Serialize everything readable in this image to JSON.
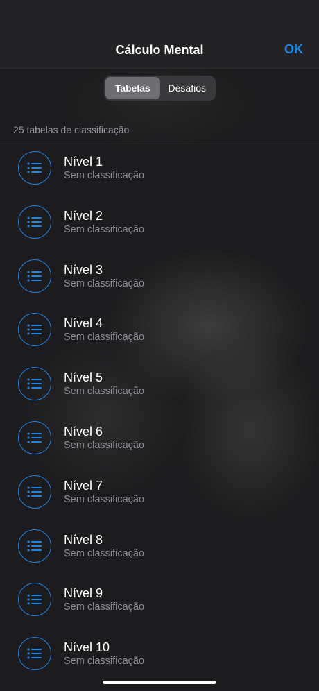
{
  "header": {
    "title": "Cálculo Mental",
    "ok_label": "OK"
  },
  "segments": [
    "Tabelas",
    "Desafios"
  ],
  "selected_segment": "Tabelas",
  "section": {
    "header": "25 tabelas de classificação"
  },
  "rows": [
    {
      "title": "Nível 1",
      "subtitle": "Sem classificação"
    },
    {
      "title": "Nível 2",
      "subtitle": "Sem classificação"
    },
    {
      "title": "Nível 3",
      "subtitle": "Sem classificação"
    },
    {
      "title": "Nível 4",
      "subtitle": "Sem classificação"
    },
    {
      "title": "Nível 5",
      "subtitle": "Sem classificação"
    },
    {
      "title": "Nível 6",
      "subtitle": "Sem classificação"
    },
    {
      "title": "Nível 7",
      "subtitle": "Sem classificação"
    },
    {
      "title": "Nível 8",
      "subtitle": "Sem classificação"
    },
    {
      "title": "Nível 9",
      "subtitle": "Sem classificação"
    },
    {
      "title": "Nível 10",
      "subtitle": "Sem classificação"
    }
  ],
  "row_icon": "list-icon",
  "colors": {
    "accent": "#1a86ea",
    "background": "#1c1c1e",
    "secondary_text": "#8e8e93"
  }
}
